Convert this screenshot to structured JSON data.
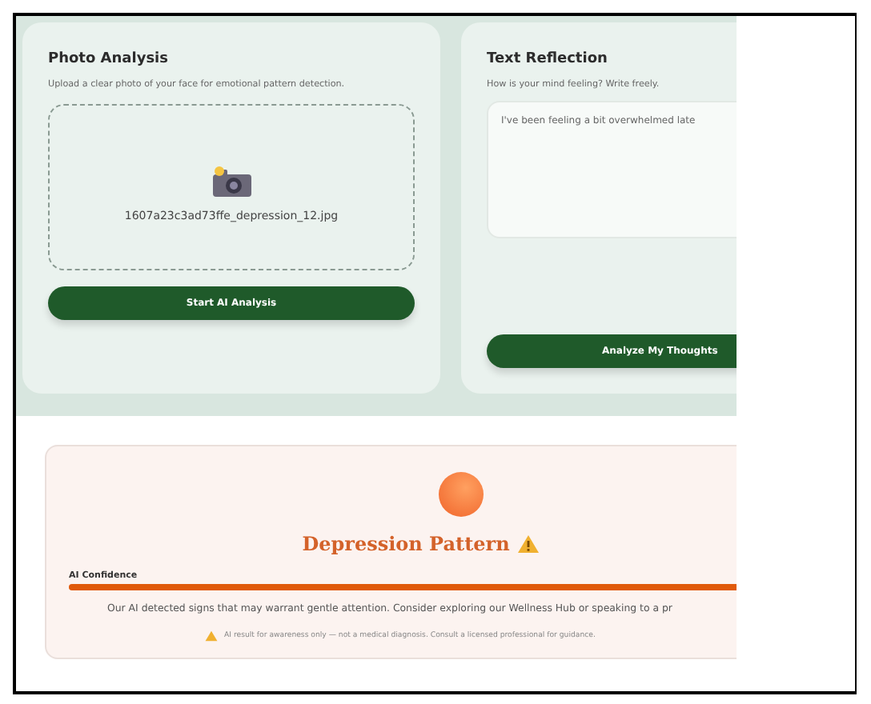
{
  "photo_card": {
    "title": "Photo Analysis",
    "subtitle": "Upload a clear photo of your face for emotional pattern detection.",
    "file_name": "1607a23c3ad73ffe_depression_12.jpg",
    "button": "Start AI Analysis"
  },
  "text_card": {
    "title": "Text Reflection",
    "subtitle": "How is your mind feeling? Write freely.",
    "placeholder": "I've been feeling a bit overwhelmed late",
    "button": "Analyze My Thoughts"
  },
  "result": {
    "title": "Depression Pattern",
    "confidence_label": "AI Confidence",
    "level": 1,
    "message": "Our AI detected signs that may warrant gentle attention. Consider exploring our Wellness Hub or speaking to a pr",
    "disclaimer": "AI result for awareness only — not a medical diagnosis. Consult a licensed professional for guidance."
  }
}
